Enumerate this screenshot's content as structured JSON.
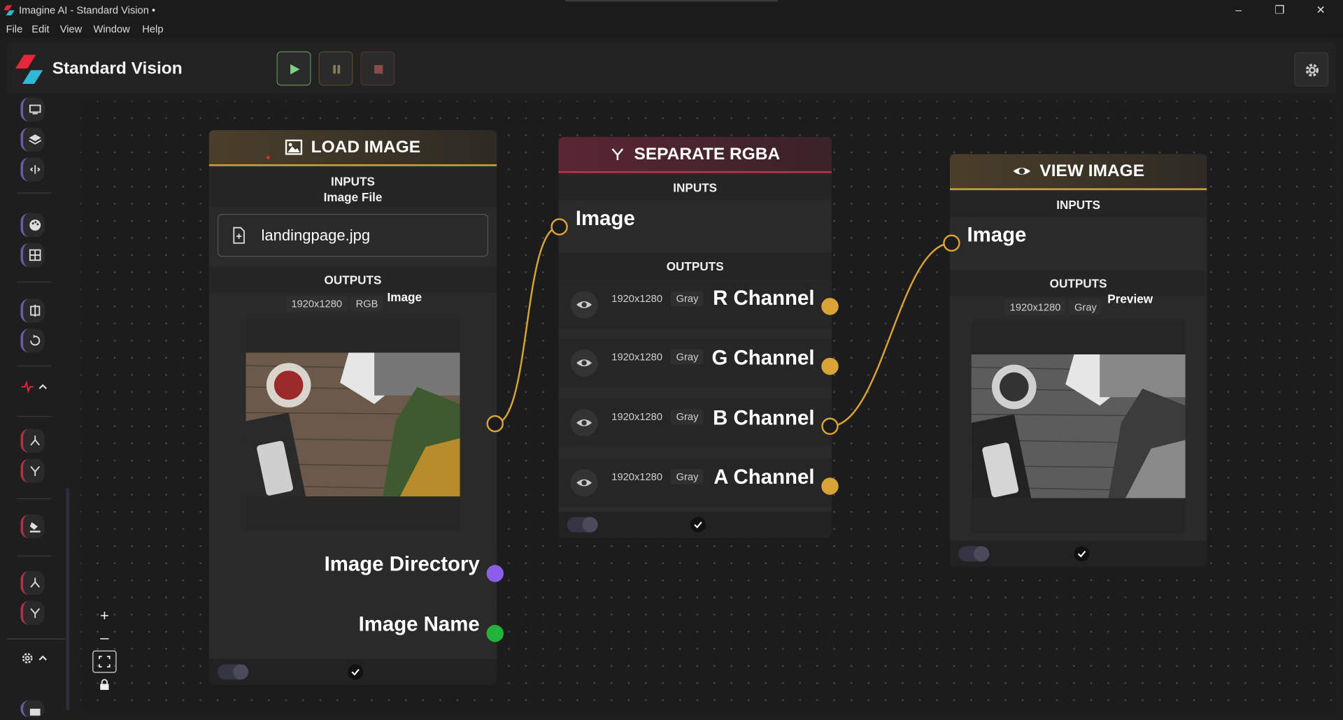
{
  "window": {
    "title": "Imagine AI - Standard Vision •",
    "controls": {
      "minimize": "–",
      "maximize": "❐",
      "close": "✕"
    }
  },
  "menu": [
    "File",
    "Edit",
    "View",
    "Window",
    "Help"
  ],
  "header": {
    "app_name": "Standard Vision"
  },
  "colors": {
    "accent_gold": "#d9a336",
    "accent_red": "#c8314a",
    "handle_purple": "#8a5ee8",
    "handle_green": "#22b33a",
    "play_green": "#7fd07f"
  },
  "nodes": {
    "load_image": {
      "title": "LOAD IMAGE",
      "inputs_label": "INPUTS",
      "input_field_label": "Image File",
      "file_name": "landingpage.jpg",
      "outputs_label": "OUTPUTS",
      "out_size": "1920x1280",
      "out_mode": "RGB",
      "out_name": "Image",
      "extra_outputs": [
        "Image Directory",
        "Image Name"
      ]
    },
    "separate_rgba": {
      "title": "SEPARATE RGBA",
      "inputs_label": "INPUTS",
      "input_name": "Image",
      "outputs_label": "OUTPUTS",
      "channels": [
        {
          "size": "1920x1280",
          "mode": "Gray",
          "name": "R Channel"
        },
        {
          "size": "1920x1280",
          "mode": "Gray",
          "name": "G Channel"
        },
        {
          "size": "1920x1280",
          "mode": "Gray",
          "name": "B Channel"
        },
        {
          "size": "1920x1280",
          "mode": "Gray",
          "name": "A Channel"
        }
      ]
    },
    "view_image": {
      "title": "VIEW IMAGE",
      "inputs_label": "INPUTS",
      "input_name": "Image",
      "outputs_label": "OUTPUTS",
      "out_size": "1920x1280",
      "out_mode": "Gray",
      "out_name": "Preview"
    }
  },
  "zoom_controls": {
    "zoom_in": "+",
    "zoom_out": "–"
  }
}
